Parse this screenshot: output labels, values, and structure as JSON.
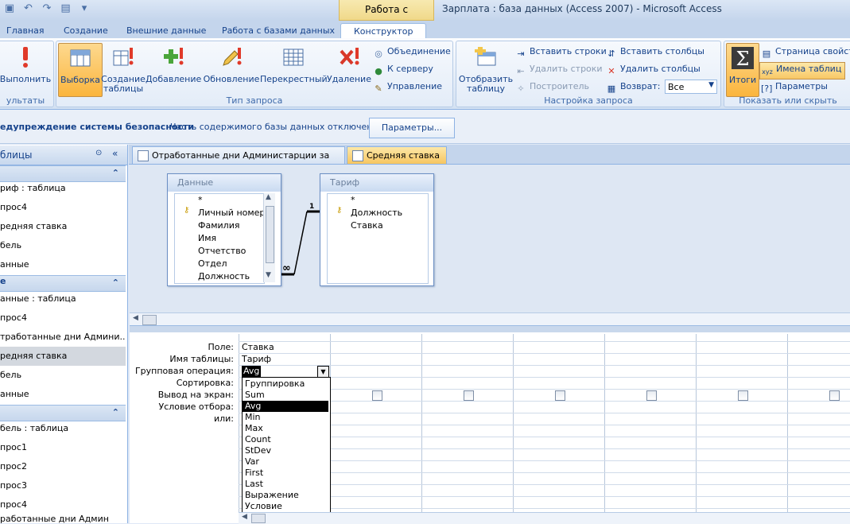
{
  "window": {
    "app_title": "Зарплата : база данных (Access 2007) - Microsoft Access",
    "contextual_tab_group": "Работа с запросами"
  },
  "ribbon_tabs": [
    "Главная",
    "Создание",
    "Внешние данные",
    "Работа с базами данных",
    "Конструктор"
  ],
  "ribbon": {
    "results_group_label": "ультаты",
    "run_label": "Выполнить",
    "query_type": {
      "label": "Тип запроса",
      "buttons": [
        "Выборка",
        "Создание таблицы",
        "Добавление",
        "Обновление",
        "Перекрестный",
        "Удаление"
      ],
      "small": [
        "Объединение",
        "К серверу",
        "Управление"
      ]
    },
    "setup": {
      "label": "Настройка запроса",
      "show_table": "Отобразить таблицу",
      "insert_rows": "Вставить строки",
      "delete_rows": "Удалить строки",
      "builder": "Построитель",
      "insert_cols": "Вставить столбцы",
      "delete_cols": "Удалить столбцы",
      "return_label": "Возврат:",
      "return_value": "Все"
    },
    "show_hide": {
      "label": "Показать или скрыть",
      "totals": "Итоги",
      "property_sheet": "Страница свойств",
      "table_names": "Имена таблиц",
      "parameters": "Параметры"
    }
  },
  "message_bar": {
    "warning": "едупреждение системы безопасности",
    "message": "Часть содержимого базы данных отключено",
    "button": "Параметры..."
  },
  "nav": {
    "header": "блицы",
    "groups": [
      {
        "title": "",
        "items": [
          "риф : таблица",
          "прос4",
          "редняя ставка",
          "бель",
          "анные"
        ]
      },
      {
        "title": "е",
        "items": [
          "анные : таблица",
          "прос4",
          "траб­отанные дни Админи...",
          "редняя ставка",
          "бель",
          "анные"
        ]
      },
      {
        "title": "",
        "items": [
          "бель : таблица",
          "прос1",
          "прос2",
          "прос3",
          "прос4",
          "работанные дни Админ"
        ]
      }
    ]
  },
  "doc_tabs": [
    "Отработанные дни Администарции за май",
    "Средняя ставка"
  ],
  "tables": [
    {
      "title": "Данные",
      "fields": [
        "*",
        "Личный номер",
        "Фамилия",
        "Имя",
        "Отчетство",
        "Отдел",
        "Должность"
      ]
    },
    {
      "title": "Тариф",
      "fields": [
        "*",
        "Должность",
        "Ставка"
      ]
    }
  ],
  "relation": {
    "one": "1",
    "many": "∞"
  },
  "grid": {
    "row_labels": [
      "Поле:",
      "Имя таблицы:",
      "Групповая операция:",
      "Сортировка:",
      "Вывод на экран:",
      "Условие отбора:",
      "или:"
    ],
    "field": "Ставка",
    "table": "Тариф",
    "total": "Avg"
  },
  "dropdown_options": [
    "Группировка",
    "Sum",
    "Avg",
    "Min",
    "Max",
    "Count",
    "StDev",
    "Var",
    "First",
    "Last",
    "Выражение",
    "Условие"
  ],
  "dropdown_selected": "Avg"
}
